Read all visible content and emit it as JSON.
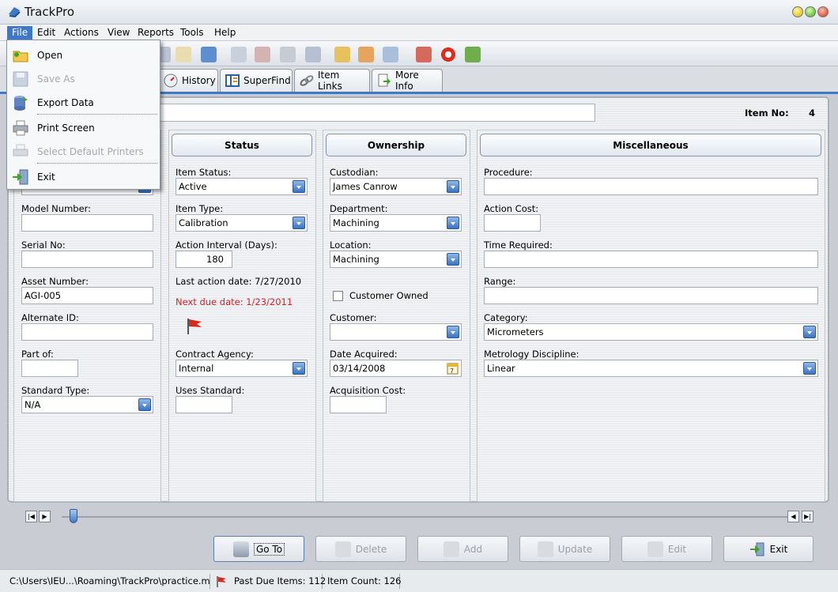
{
  "app": {
    "title": "TrackPro",
    "accent": "#3f78c8"
  },
  "menubar": [
    "File",
    "Edit",
    "Actions",
    "View",
    "Reports",
    "Tools",
    "Help"
  ],
  "file_menu": {
    "items": [
      {
        "label": "Open",
        "enabled": true,
        "icon": "folder-icon"
      },
      {
        "label": "Save As",
        "enabled": false,
        "icon": "save-icon"
      },
      {
        "label": "Export Data",
        "enabled": true,
        "icon": "database-export-icon"
      },
      {
        "label": "Print Screen",
        "enabled": true,
        "icon": "printer-icon"
      },
      {
        "label": "Select Default Printers",
        "enabled": false,
        "icon": "printer-select-icon"
      },
      {
        "label": "Exit",
        "enabled": true,
        "icon": "exit-door-icon"
      }
    ]
  },
  "tabs": [
    {
      "label": "History",
      "icon": "gauge-icon"
    },
    {
      "label": "SuperFind",
      "icon": "superfind-icon"
    },
    {
      "label": "Item Links",
      "icon": "chain-link-icon"
    },
    {
      "label": "More Info",
      "icon": "page-arrow-icon"
    }
  ],
  "header": {
    "item_no_label": "Item No:",
    "item_no": "4",
    "description": ""
  },
  "identification": {
    "model_number_label": "Model Number:",
    "model_number": "",
    "serial_no_label": "Serial No:",
    "serial_no": "",
    "asset_number_label": "Asset Number:",
    "asset_number": "AGI-005",
    "alternate_id_label": "Alternate ID:",
    "alternate_id": "",
    "part_of_label": "Part of:",
    "part_of": "",
    "standard_type_label": "Standard Type:",
    "standard_type": "N/A"
  },
  "status": {
    "title": "Status",
    "item_status_label": "Item Status:",
    "item_status": "Active",
    "item_type_label": "Item Type:",
    "item_type": "Calibration",
    "action_interval_label": "Action Interval (Days):",
    "action_interval": "180",
    "last_action": "Last action date: 7/27/2010",
    "next_due": "Next due date: 1/23/2011",
    "next_due_color": "#e02020",
    "contract_agency_label": "Contract Agency:",
    "contract_agency": "Internal",
    "uses_standard_label": "Uses Standard:",
    "uses_standard": ""
  },
  "ownership": {
    "title": "Ownership",
    "custodian_label": "Custodian:",
    "custodian": "James Canrow",
    "department_label": "Department:",
    "department": "Machining",
    "location_label": "Location:",
    "location": "Machining",
    "customer_owned_label": "Customer Owned",
    "customer_owned": false,
    "customer_label": "Customer:",
    "customer": "",
    "date_acquired_label": "Date Acquired:",
    "date_acquired": "03/14/2008",
    "acquisition_cost_label": "Acquisition Cost:",
    "acquisition_cost": ""
  },
  "misc": {
    "title": "Miscellaneous",
    "procedure_label": "Procedure:",
    "procedure": "",
    "action_cost_label": "Action Cost:",
    "action_cost": "",
    "time_required_label": "Time Required:",
    "time_required": "",
    "range_label": "Range:",
    "range": "",
    "category_label": "Category:",
    "category": "Micrometers",
    "discipline_label": "Metrology Discipline:",
    "discipline": "Linear"
  },
  "actions": [
    {
      "label": "Go To",
      "enabled": true
    },
    {
      "label": "Delete",
      "enabled": false
    },
    {
      "label": "Add",
      "enabled": false
    },
    {
      "label": "Update",
      "enabled": false
    },
    {
      "label": "Edit",
      "enabled": false
    },
    {
      "label": "Exit",
      "enabled": true
    }
  ],
  "statusbar": {
    "path": "C:\\Users\\IEU...\\Roaming\\TrackPro\\practice.m...",
    "past_due": "Past Due Items: 112",
    "item_count": "Item Count: 126"
  }
}
